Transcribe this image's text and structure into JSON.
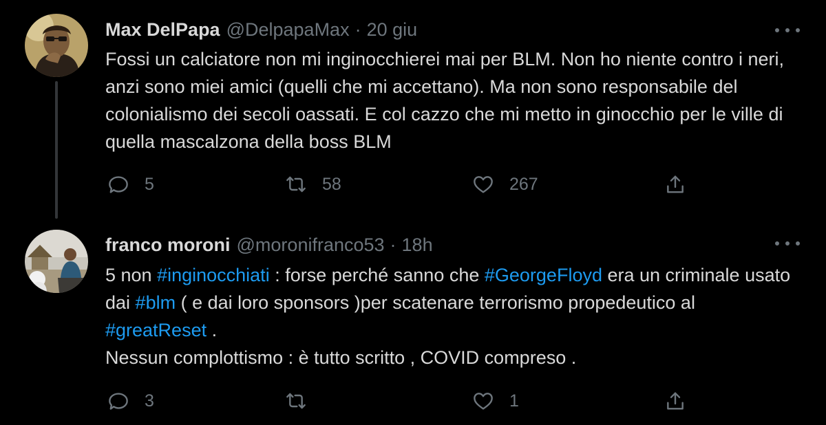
{
  "colors": {
    "background": "#000000",
    "text": "#d9d9d9",
    "secondary": "#6e767d",
    "link": "#1d9bf0",
    "thread_line": "#333639"
  },
  "icons": {
    "more": "more-icon",
    "reply": "reply-icon",
    "retweet": "retweet-icon",
    "like": "like-icon",
    "share": "share-icon"
  },
  "tweets": [
    {
      "name": "Max DelPapa",
      "handle": "@DelpapaMax",
      "separator": "·",
      "time": "20 giu",
      "text": "Fossi un calciatore non mi inginocchierei mai per BLM. Non ho niente contro i neri, anzi sono miei amici (quelli che mi accettano). Ma non sono responsabile del colonialismo dei secoli oassati. E col cazzo che mi metto in ginocchio per le ville di quella mascalzona della boss BLM",
      "replies": "5",
      "retweets": "58",
      "likes": "267"
    },
    {
      "name": "franco moroni",
      "handle": "@moronifranco53",
      "separator": "·",
      "time": "18h",
      "text": {
        "s1": "5 non ",
        "h1": "#inginocchiati",
        "s2": " : forse perché sanno che ",
        "h2": "#GeorgeFloyd",
        "s3": " era un criminale usato dai ",
        "h3": "#blm",
        "s4": " ( e dai loro sponsors )per scatenare terrorismo propedeutico al ",
        "h4": "#greatReset",
        "s5": " .\nNessun complottismo : è tutto scritto , COVID compreso ."
      },
      "replies": "3",
      "retweets": "",
      "likes": "1"
    }
  ]
}
